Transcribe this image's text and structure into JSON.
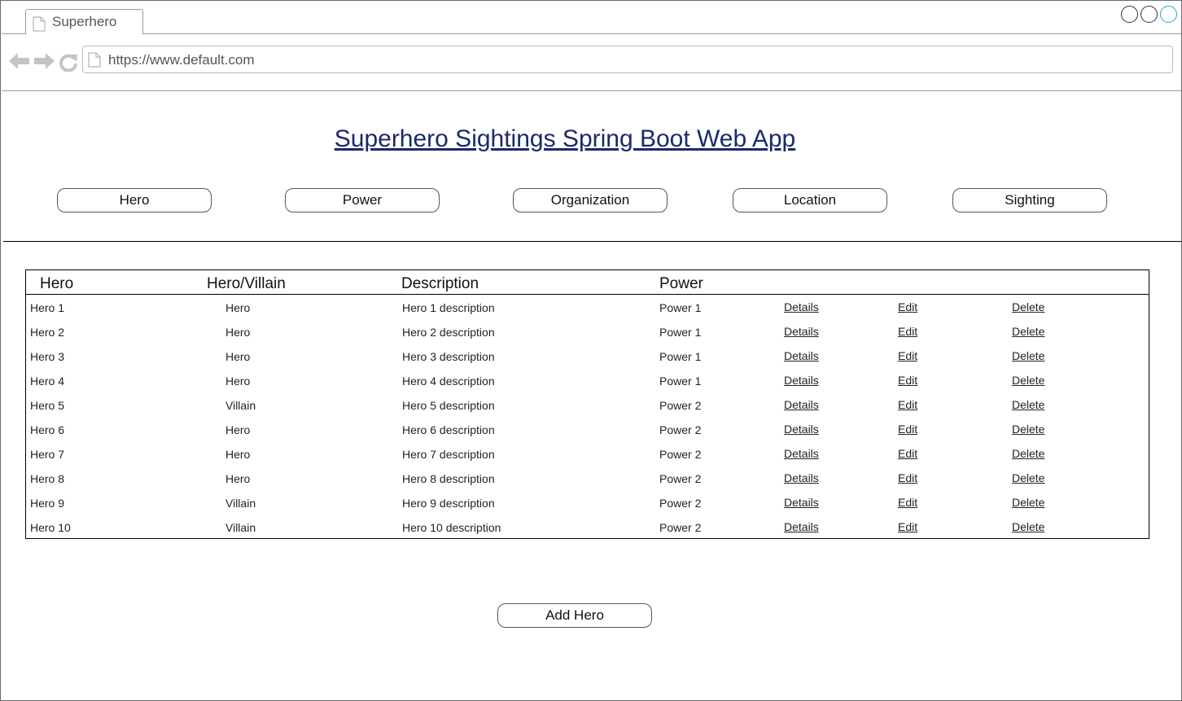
{
  "browser": {
    "tab_title": "Superhero",
    "url": "https://www.default.com"
  },
  "page": {
    "title": "Superhero Sightings Spring Boot Web App"
  },
  "nav": [
    "Hero",
    "Power",
    "Organization",
    "Location",
    "Sighting"
  ],
  "table": {
    "headers": [
      "Hero",
      "Hero/Villain",
      "Description",
      "Power"
    ],
    "action_labels": [
      "Details",
      "Edit",
      "Delete"
    ],
    "rows": [
      {
        "name": "Hero 1",
        "type": "Hero",
        "description": "Hero 1 description",
        "power": "Power 1"
      },
      {
        "name": "Hero 2",
        "type": "Hero",
        "description": "Hero 2 description",
        "power": "Power 1"
      },
      {
        "name": "Hero 3",
        "type": "Hero",
        "description": "Hero 3 description",
        "power": "Power 1"
      },
      {
        "name": "Hero 4",
        "type": "Hero",
        "description": "Hero 4 description",
        "power": "Power 1"
      },
      {
        "name": "Hero 5",
        "type": "Villain",
        "description": "Hero 5 description",
        "power": "Power 2"
      },
      {
        "name": "Hero 6",
        "type": "Hero",
        "description": "Hero 6 description",
        "power": "Power 2"
      },
      {
        "name": "Hero 7",
        "type": "Hero",
        "description": "Hero 7 description",
        "power": "Power 2"
      },
      {
        "name": "Hero 8",
        "type": "Hero",
        "description": "Hero 8 description",
        "power": "Power 2"
      },
      {
        "name": "Hero 9",
        "type": "Villain",
        "description": "Hero 9 description",
        "power": "Power 2"
      },
      {
        "name": "Hero 10",
        "type": "Villain",
        "description": "Hero 10 description",
        "power": "Power 2"
      }
    ]
  },
  "add_button": "Add Hero",
  "icons": {
    "tab": "document-icon",
    "back": "back-arrow-icon",
    "forward": "forward-arrow-icon",
    "reload": "reload-icon",
    "address": "document-icon"
  },
  "colors": {
    "title": "#1a2a6b",
    "icon_gray": "#c4c4c4",
    "window_control_accent": "#2a9fd6"
  }
}
